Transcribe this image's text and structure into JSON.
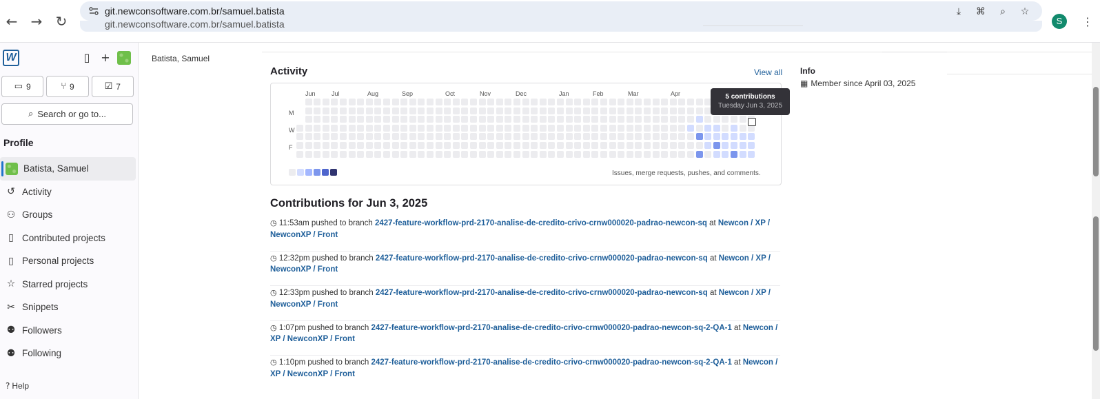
{
  "browser": {
    "url": "git.newconsoftware.com.br/samuel.batista",
    "url_ghost": "git.newconsoftware.com.br/samuel.batista",
    "profile_initial": "S",
    "back_icon": "arrow-left-icon",
    "forward_icon": "arrow-right-icon",
    "reload_icon": "reload-icon"
  },
  "sidebar": {
    "counters": [
      {
        "icon": "issues-icon",
        "value": "9"
      },
      {
        "icon": "merge-request-icon",
        "value": "9"
      },
      {
        "icon": "todo-icon",
        "value": "7"
      }
    ],
    "search_label": "Search or go to...",
    "section_title": "Profile",
    "items": [
      {
        "label": "Batista, Samuel",
        "icon": "avatar",
        "active": true
      },
      {
        "label": "Activity",
        "icon": "history-icon"
      },
      {
        "label": "Groups",
        "icon": "groups-icon"
      },
      {
        "label": "Contributed projects",
        "icon": "project-icon"
      },
      {
        "label": "Personal projects",
        "icon": "project-icon"
      },
      {
        "label": "Starred projects",
        "icon": "star-icon"
      },
      {
        "label": "Snippets",
        "icon": "snippet-icon"
      },
      {
        "label": "Followers",
        "icon": "users-icon"
      },
      {
        "label": "Following",
        "icon": "users-icon"
      }
    ],
    "help_label": "Help"
  },
  "main": {
    "user_name": "Batista, Samuel",
    "activity_title": "Activity",
    "view_all": "View all",
    "calendar": {
      "months": [
        "Jun",
        "Jul",
        "Aug",
        "Sep",
        "Oct",
        "Nov",
        "Dec",
        "Jan",
        "Feb",
        "Mar",
        "Apr"
      ],
      "days": [
        "M",
        "W",
        "F"
      ],
      "note": "Issues, merge requests, pushes, and comments.",
      "tooltip_count": "5 contributions",
      "tooltip_date": "Tuesday Jun 3, 2025",
      "colors": [
        "#ececef",
        "#d2dcff",
        "#a3b7ff",
        "#7c96ed",
        "#4e65cd",
        "#303470"
      ]
    },
    "info_title": "Info",
    "member_since": "Member since April 03, 2025",
    "contrib_title": "Contributions for Jun 3, 2025",
    "events": [
      {
        "time": "11:53am",
        "action": "pushed to branch",
        "branch": "2427-feature-workflow-prd-2170-analise-de-credito-crivo-crnw000020-padrao-newcon-sq",
        "at": "at",
        "project": "Newcon / XP / NewconXP / Front"
      },
      {
        "time": "12:32pm",
        "action": "pushed to branch",
        "branch": "2427-feature-workflow-prd-2170-analise-de-credito-crivo-crnw000020-padrao-newcon-sq",
        "at": "at",
        "project": "Newcon / XP / NewconXP / Front"
      },
      {
        "time": "12:33pm",
        "action": "pushed to branch",
        "branch": "2427-feature-workflow-prd-2170-analise-de-credito-crivo-crnw000020-padrao-newcon-sq",
        "at": "at",
        "project": "Newcon / XP / NewconXP / Front"
      },
      {
        "time": "1:07pm",
        "action": "pushed to branch",
        "branch": "2427-feature-workflow-prd-2170-analise-de-credito-crivo-crnw000020-padrao-newcon-sq-2-QA-1",
        "at": "at",
        "project": "Newcon / XP / NewconXP / Front"
      },
      {
        "time": "1:10pm",
        "action": "pushed to branch",
        "branch": "2427-feature-workflow-prd-2170-analise-de-credito-crivo-crnw000020-padrao-newcon-sq-2-QA-1",
        "at": "at",
        "project": "Newcon / XP / NewconXP / Front"
      }
    ]
  }
}
